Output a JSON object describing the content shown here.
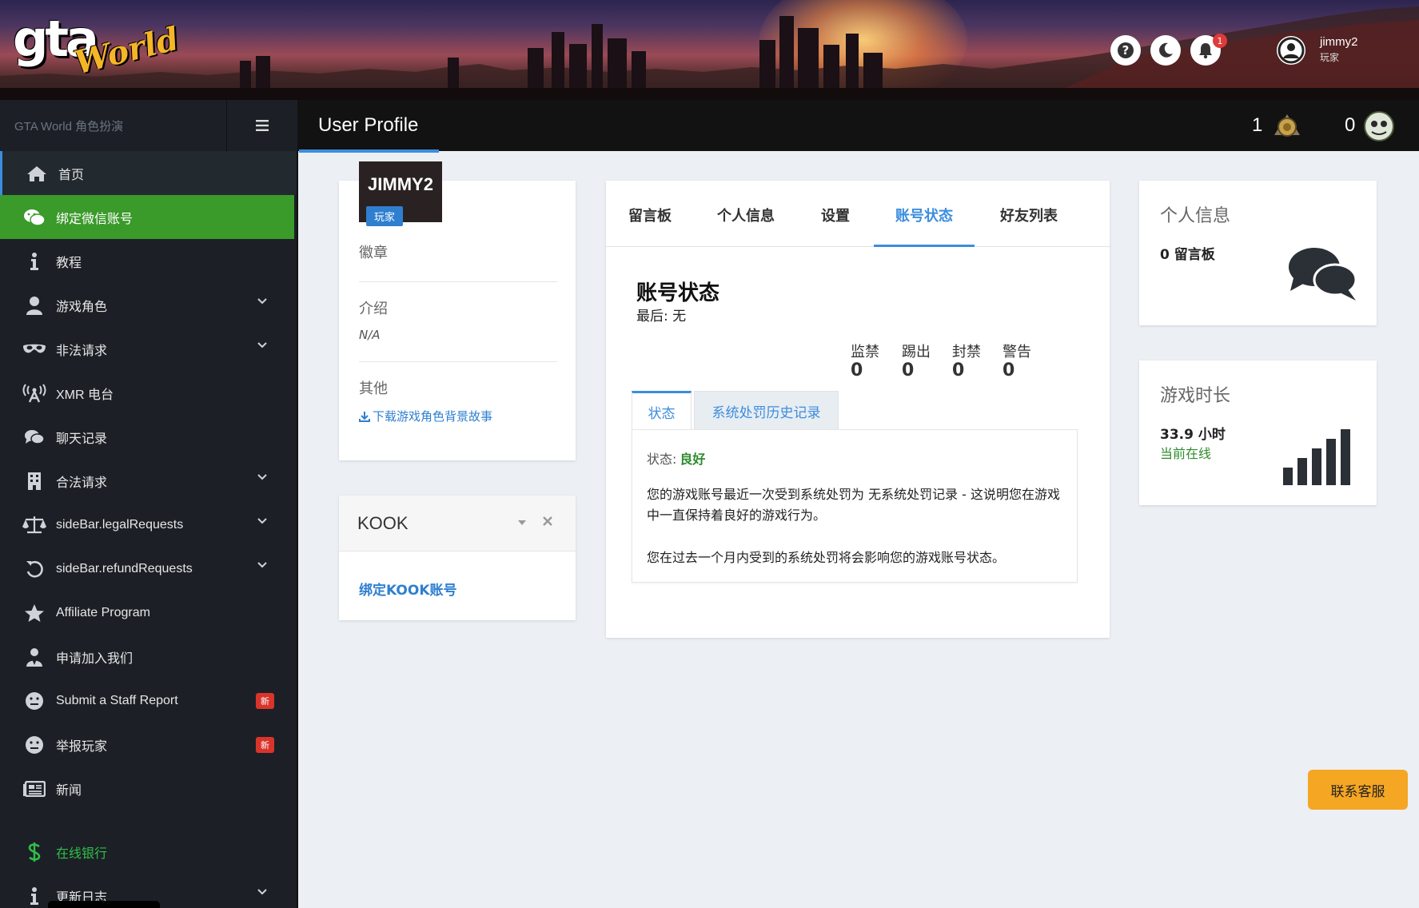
{
  "header": {
    "logo_text": "gta",
    "logo_script": "World",
    "notification_count": "1",
    "user_name": "jimmy2",
    "user_role": "玩家"
  },
  "topbar": {
    "brand": "GTA World 角色扮演",
    "page_title": "User Profile",
    "stat_a_value": "1",
    "stat_b_value": "0"
  },
  "sidebar": {
    "items": [
      {
        "label": "首页",
        "icon": "home-icon"
      },
      {
        "label": "绑定微信账号",
        "icon": "wechat-icon"
      },
      {
        "label": "教程",
        "icon": "info-icon"
      },
      {
        "label": "游戏角色",
        "icon": "user-icon"
      },
      {
        "label": "非法请求",
        "icon": "mask-icon"
      },
      {
        "label": "XMR 电台",
        "icon": "broadcast-icon"
      },
      {
        "label": "聊天记录",
        "icon": "chat-icon"
      },
      {
        "label": "合法请求",
        "icon": "building-icon"
      },
      {
        "label": "sideBar.legalRequests",
        "icon": "scale-icon"
      },
      {
        "label": "sideBar.refundRequests",
        "icon": "undo-icon"
      },
      {
        "label": "Affiliate Program",
        "icon": "star-icon"
      },
      {
        "label": "申请加入我们",
        "icon": "staff-icon"
      },
      {
        "label": "Submit a Staff Report",
        "icon": "face-icon",
        "badge": "新"
      },
      {
        "label": "举报玩家",
        "icon": "face-icon",
        "badge": "新"
      },
      {
        "label": "新闻",
        "icon": "newspaper-icon"
      },
      {
        "label": "在线银行",
        "icon": "dollar-icon"
      },
      {
        "label": "更新日志",
        "icon": "info-icon"
      }
    ]
  },
  "profile": {
    "name": "JIMMY2",
    "role_badge": "玩家",
    "badges_heading": "徽章",
    "intro_heading": "介绍",
    "intro_value": "N/A",
    "other_heading": "其他",
    "download_link": "下载游戏角色背景故事"
  },
  "kook": {
    "title": "KOOK",
    "link": "绑定KOOK账号"
  },
  "tabs": [
    "留言板",
    "个人信息",
    "设置",
    "账号状态",
    "好友列表"
  ],
  "account": {
    "title": "账号状态",
    "last": "最后: 无",
    "stats": [
      {
        "label": "监禁",
        "value": "0"
      },
      {
        "label": "踢出",
        "value": "0"
      },
      {
        "label": "封禁",
        "value": "0"
      },
      {
        "label": "警告",
        "value": "0"
      }
    ],
    "inner_tabs": [
      "状态",
      "系统处罚历史记录"
    ],
    "status_label": "状态:",
    "status_value": "良好",
    "para1": "您的游戏账号最近一次受到系统处罚为 无系统处罚记录 - 这说明您在游戏中一直保持着良好的游戏行为。",
    "para2": "您在过去一个月内受到的系统处罚将会影响您的游戏账号状态。"
  },
  "info_card": {
    "title": "个人信息",
    "value": "0 留言板"
  },
  "playtime_card": {
    "title": "游戏时长",
    "value": "33.9 小时",
    "status": "当前在线"
  },
  "support_button": "联系客服",
  "colors": {
    "accent": "#3c8dde",
    "wechat_green": "#3a9a2a",
    "good_green": "#2e8b2e",
    "badge_red": "#d9342b",
    "support_orange": "#f5a623"
  }
}
